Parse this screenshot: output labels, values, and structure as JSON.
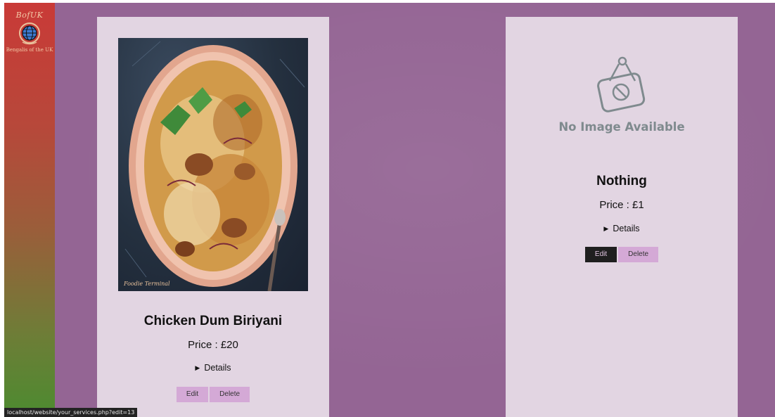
{
  "sidebar": {
    "logo_title": "BofUK",
    "logo_subtitle": "Bengalis of the UK",
    "gradient_colors": [
      "#c93a37",
      "#4c8b30"
    ]
  },
  "theme": {
    "background": "#946594",
    "card_background": "#e2d5e2",
    "button_color": "#d4a9d6",
    "edit_active_color": "#1f1f1f"
  },
  "services": [
    {
      "title": "Chicken Dum Biriyani",
      "price": "Price : £20",
      "details_label": "Details",
      "image_watermark": "Foodie Terminal",
      "edit_label": "Edit",
      "delete_label": "Delete"
    },
    {
      "title": "Nothing",
      "price": "Price : £1",
      "details_label": "Details",
      "no_image_text": "No Image Available",
      "edit_label": "Edit",
      "delete_label": "Delete"
    }
  ],
  "status_bar": {
    "url": "localhost/website/your_services.php?edit=13"
  }
}
